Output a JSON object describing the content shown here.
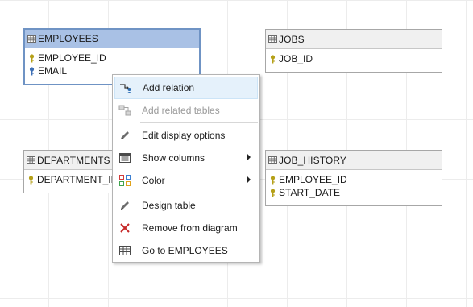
{
  "tables": {
    "employees": {
      "title": "EMPLOYEES",
      "columns": [
        "EMPLOYEE_ID",
        "EMAIL"
      ]
    },
    "jobs": {
      "title": "JOBS",
      "columns": [
        "JOB_ID"
      ]
    },
    "departments": {
      "title": "DEPARTMENTS",
      "columns": [
        "DEPARTMENT_ID"
      ]
    },
    "job_history": {
      "title": "JOB_HISTORY",
      "columns": [
        "EMPLOYEE_ID",
        "START_DATE"
      ]
    }
  },
  "context_menu": {
    "items": [
      {
        "label": "Add relation",
        "icon": "add-relation-icon",
        "state": "hover"
      },
      {
        "label": "Add related tables",
        "icon": "related-tables-icon",
        "state": "disabled"
      },
      {
        "label": "Edit display options",
        "icon": "pencil-icon"
      },
      {
        "label": "Show columns",
        "icon": "columns-icon",
        "submenu": true
      },
      {
        "label": "Color",
        "icon": "color-palette-icon",
        "submenu": true
      },
      {
        "label": "Design table",
        "icon": "pencil-icon"
      },
      {
        "label": "Remove from diagram",
        "icon": "red-x-icon"
      },
      {
        "label": "Go to EMPLOYEES",
        "icon": "table-grid-icon"
      }
    ]
  },
  "colors": {
    "selected_border": "#6f93c4",
    "selected_header": "#a9c1e5",
    "primary_key": "#b5a018",
    "unique_key": "#3d6fb5",
    "menu_hover": "#e5f1fb",
    "remove_icon": "#c62828"
  }
}
